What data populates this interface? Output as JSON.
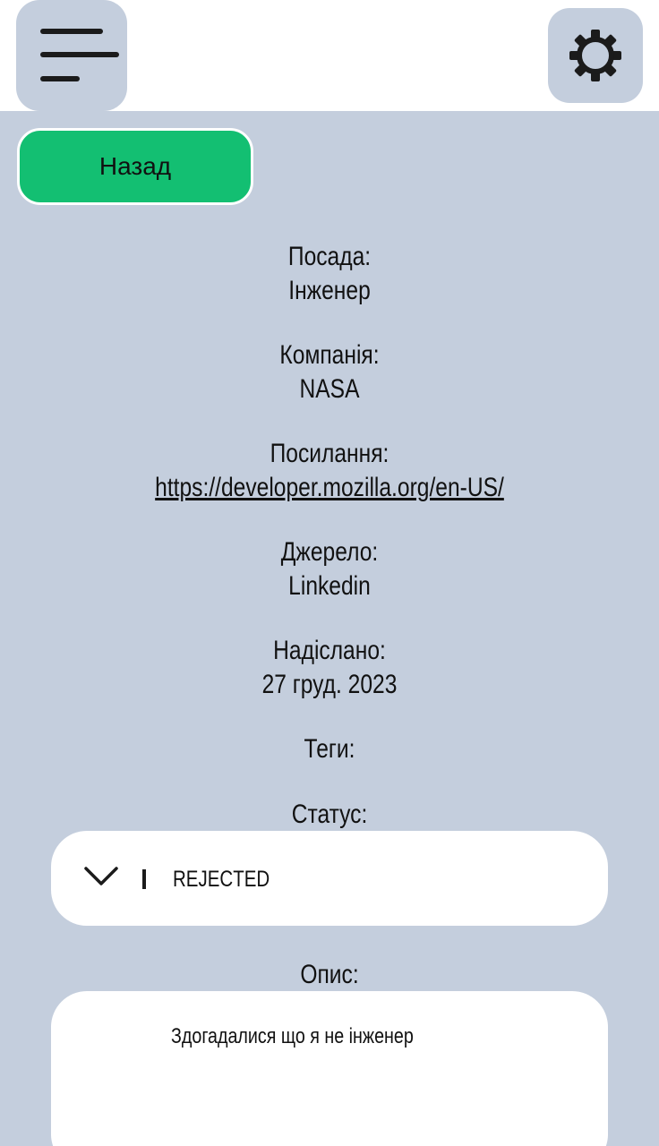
{
  "header": {
    "menu_icon": "hamburger-menu-icon",
    "settings_icon": "gear-icon"
  },
  "back_button": {
    "label": "Назад"
  },
  "details": {
    "position_label": "Посада:",
    "position_value": "Інженер",
    "company_label": "Компанія:",
    "company_value": "NASA",
    "link_label": "Посилання:",
    "link_value": "https://developer.mozilla.org/en-US/",
    "source_label": "Джерело:",
    "source_value": "Linkedin",
    "sent_label": "Надіслано:",
    "sent_value": "27 груд. 2023",
    "tags_label": "Теги:",
    "status_label": "Статус:",
    "description_label": "Опис:"
  },
  "status_select": {
    "selected": "REJECTED",
    "icon": "chevron-down-icon"
  },
  "description": {
    "text": "Здогадалися що я не інженер"
  },
  "colors": {
    "background": "#c4cedd",
    "topbar": "#ffffff",
    "accent_green": "#13bf72"
  }
}
